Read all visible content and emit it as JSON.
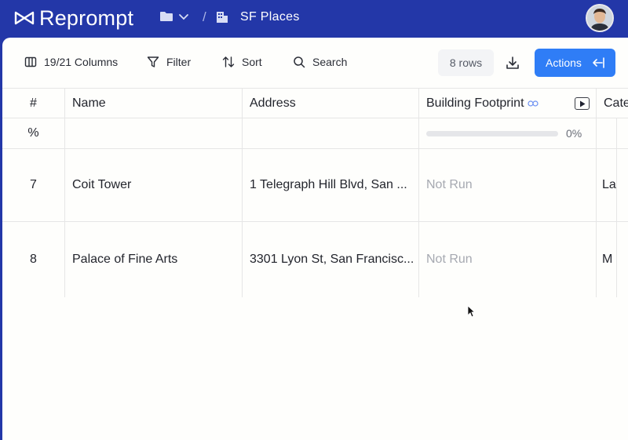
{
  "brand": {
    "name": "Reprompt"
  },
  "breadcrumb": {
    "separator": "/",
    "title": "SF Places"
  },
  "toolbar": {
    "columns_label": "19/21 Columns",
    "filter_label": "Filter",
    "sort_label": "Sort",
    "search_label": "Search",
    "rows_badge": "8 rows",
    "actions_label": "Actions"
  },
  "table": {
    "headers": {
      "index": "#",
      "name": "Name",
      "address": "Address",
      "footprint": "Building Footprint",
      "category": "Cate"
    },
    "summary": {
      "index": "%",
      "progress_label": "0%",
      "progress_value": 0
    },
    "rows": [
      {
        "index": "7",
        "name": "Coit Tower",
        "address": "1 Telegraph Hill Blvd, San ...",
        "footprint": "Not Run",
        "category": "La"
      },
      {
        "index": "8",
        "name": "Palace of Fine Arts",
        "address": "3301 Lyon St, San Francisc...",
        "footprint": "Not Run",
        "category": "M"
      }
    ]
  },
  "colors": {
    "topbar": "#2337a8",
    "accent": "#2f7df6"
  }
}
